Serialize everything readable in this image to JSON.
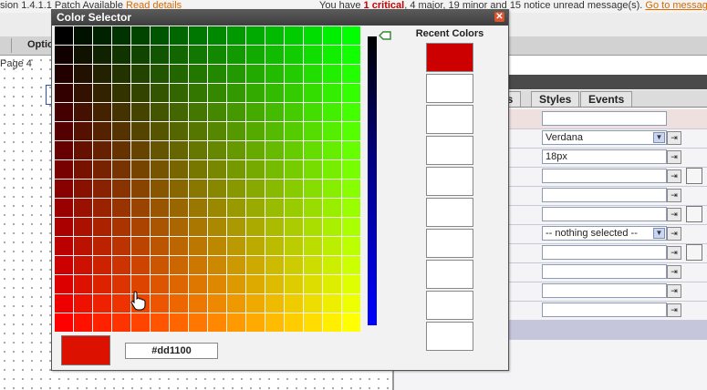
{
  "topbar": {
    "version_text": "sion 1.4.1.1 Patch Available",
    "read_details": "Read details",
    "msg_prefix": "You have",
    "critical_count": "1",
    "critical_label": "critical",
    "major_text": "4 major,",
    "minor_text": "19 minor and",
    "notice_text": "15 notice unread message(s).",
    "goto_link": "Go to message"
  },
  "menubar": {
    "options_label": "Optio"
  },
  "canvas": {
    "page_label": "Page 4"
  },
  "panel": {
    "tabs": [
      "es",
      "Styles",
      "Events"
    ],
    "rows": [
      {
        "value": "",
        "control": "text"
      },
      {
        "value": "Verdana",
        "control": "select"
      },
      {
        "value": "18px",
        "control": "text"
      },
      {
        "value": "",
        "control": "text"
      },
      {
        "value": "",
        "control": "text"
      },
      {
        "value": "",
        "control": "text"
      },
      {
        "value": "-- nothing selected --",
        "control": "select"
      },
      {
        "value": "",
        "control": "text"
      },
      {
        "value": "",
        "control": "text"
      },
      {
        "value": "",
        "control": "text"
      },
      {
        "value": "",
        "control": "text"
      }
    ]
  },
  "dialog": {
    "title": "Color Selector",
    "recent_title": "Recent Colors",
    "recent_colors": [
      "#cc0000",
      "",
      "",
      "",
      "",
      "",
      "",
      "",
      "",
      ""
    ],
    "selected_hex": "#dd1100",
    "selected_color": "#dd1100",
    "palette": {
      "columns": 16,
      "rows": 16,
      "red_max": 255,
      "green_max": 255
    },
    "close_icon": "close-icon",
    "cursor_icon": "hand-pointer-icon",
    "marker_icon": "slider-marker-icon"
  }
}
